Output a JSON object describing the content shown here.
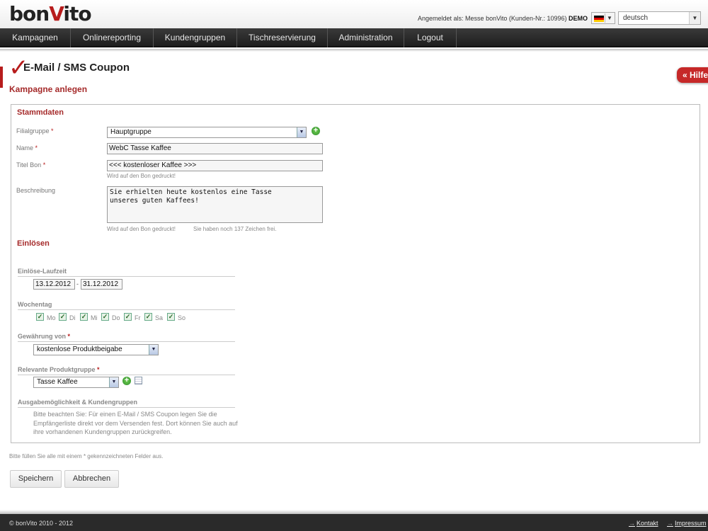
{
  "header": {
    "logo_text_pre": "bon",
    "logo_text_v": "V",
    "logo_text_post": "ito",
    "login_prefix": "Angemeldet als: Messe bonVito (Kunden-Nr.: 10996)",
    "login_badge": "DEMO",
    "language": "deutsch"
  },
  "nav": {
    "items": [
      "Kampagnen",
      "Onlinereporting",
      "Kundengruppen",
      "Tischreservierung",
      "Administration",
      "Logout"
    ]
  },
  "page": {
    "title": "E-Mail / SMS Coupon",
    "subtitle": "Kampagne anlegen",
    "help_label": "« Hilfe"
  },
  "stammdaten": {
    "heading": "Stammdaten",
    "filialgruppe_label": "Filialgruppe",
    "filialgruppe_value": "Hauptgruppe",
    "name_label": "Name",
    "name_value": "WebC Tasse Kaffee",
    "titel_label": "Titel Bon",
    "titel_value": "<<< kostenloser Kaffee >>>",
    "titel_hint": "Wird auf den Bon gedruckt!",
    "beschreibung_label": "Beschreibung",
    "beschreibung_value": "Sie erhielten heute kostenlos eine Tasse\nunseres guten Kaffees!",
    "beschreibung_hint": "Wird auf den Bon gedruckt!",
    "chars_left": "Sie haben noch 137 Zeichen frei."
  },
  "einloesen": {
    "heading": "Einlösen",
    "laufzeit_label": "Einlöse-Laufzeit",
    "date_from": "13.12.2012",
    "date_sep": "-",
    "date_to": "31.12.2012",
    "wochentag_label": "Wochentag",
    "days": [
      "Mo",
      "Di",
      "Mi",
      "Do",
      "Fr",
      "Sa",
      "So"
    ],
    "gewaehrung_label": "Gewährung von",
    "gewaehrung_value": "kostenlose Produktbeigabe",
    "produktgruppe_label": "Relevante Produktgruppe",
    "produktgruppe_value": "Tasse Kaffee",
    "ausgabe_label": "Ausgabemöglichkeit & Kundengruppen",
    "ausgabe_note": "Bitte beachten Sie: Für einen E-Mail / SMS Coupon legen Sie die Empfängerliste direkt vor dem Versenden fest. Dort können Sie auch auf ihre vorhandenen Kundengruppen zurückgreifen."
  },
  "form": {
    "required_note": "Bitte füllen Sie alle mit einem * gekennzeichneten Felder aus.",
    "save_label": "Speichern",
    "cancel_label": "Abbrechen",
    "required_marker": "*"
  },
  "footer": {
    "copyright": "© bonVito 2010 - 2012",
    "kontakt": "Kontakt",
    "impressum": "Impressum"
  }
}
